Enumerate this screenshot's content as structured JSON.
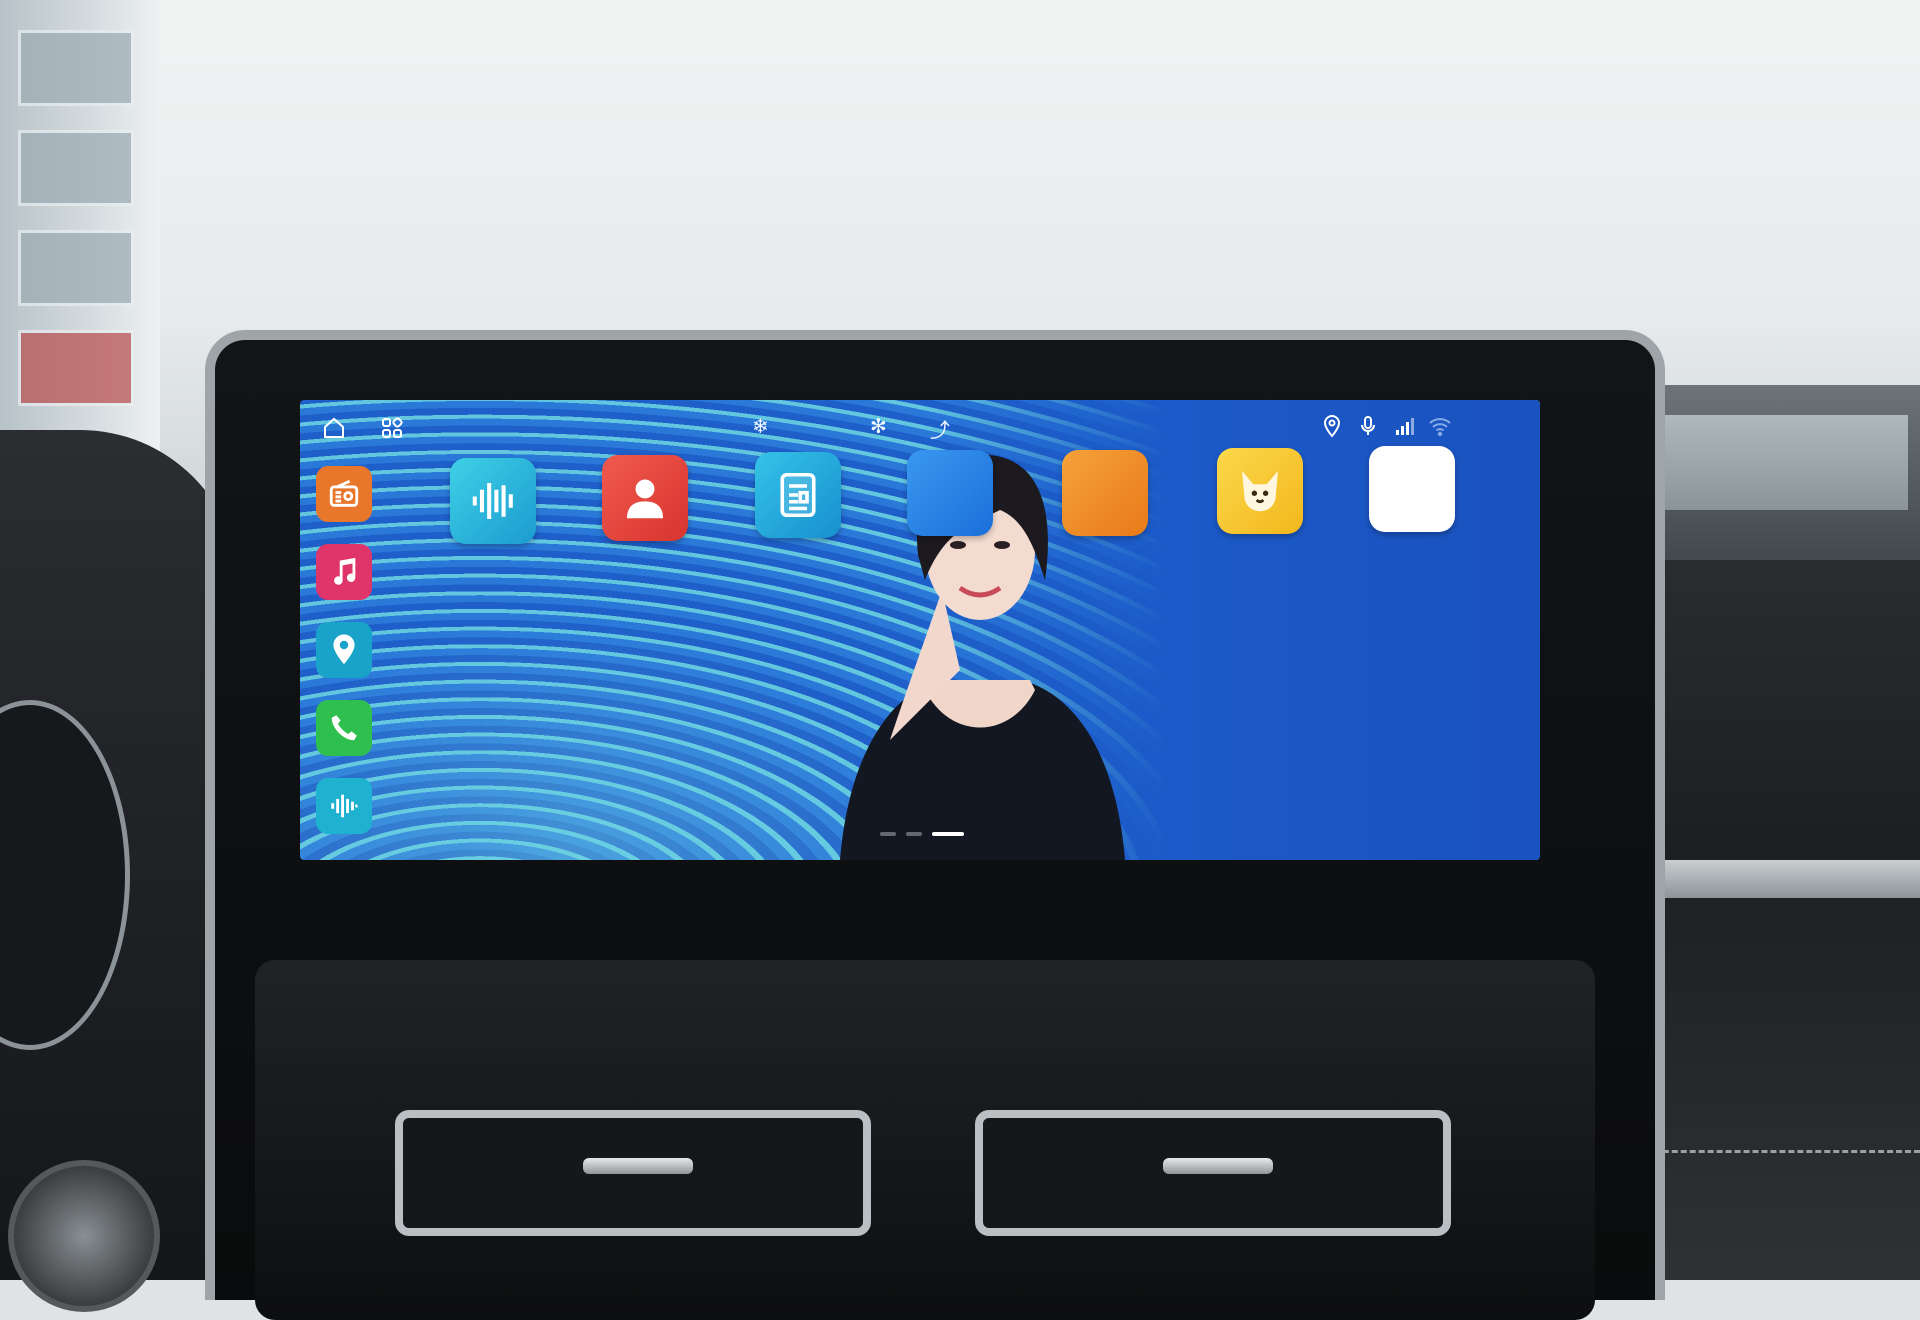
{
  "statusbar": {
    "ac_value": "",
    "fan_value": "",
    "outside_label": "",
    "outside_temp": "",
    "clock": ""
  },
  "dock": {
    "items": [
      {
        "name": "radio-icon",
        "color": "#e8772b"
      },
      {
        "name": "music-icon",
        "color": "#e0356a"
      },
      {
        "name": "navigation-pin-icon",
        "color": "#1aa3c9"
      },
      {
        "name": "phone-icon",
        "color": "#2fbf4e"
      },
      {
        "name": "voice-wave-icon",
        "color": "#1fb2d0"
      }
    ]
  },
  "apps": [
    {
      "label": "",
      "icon": "voice-wave-icon",
      "color": "#28b8d8"
    },
    {
      "label": "",
      "icon": "person-icon",
      "color": "#ea4a42"
    },
    {
      "label": "",
      "icon": "news-icon",
      "color": "#1ba7d6"
    },
    {
      "label": "",
      "icon_text": "",
      "icon": "life-service-icon",
      "color": "#1f7fe6"
    },
    {
      "label": "",
      "icon_text": "",
      "icon": "car-service-icon",
      "color": "#f08a22"
    },
    {
      "label": "",
      "icon": "fox-icon",
      "color": "#f4c62d"
    },
    {
      "label": "",
      "icon_text": "",
      "icon": "sina-icon",
      "color": "#ffffff"
    }
  ],
  "pager": {
    "pages": 3,
    "active": 3
  }
}
